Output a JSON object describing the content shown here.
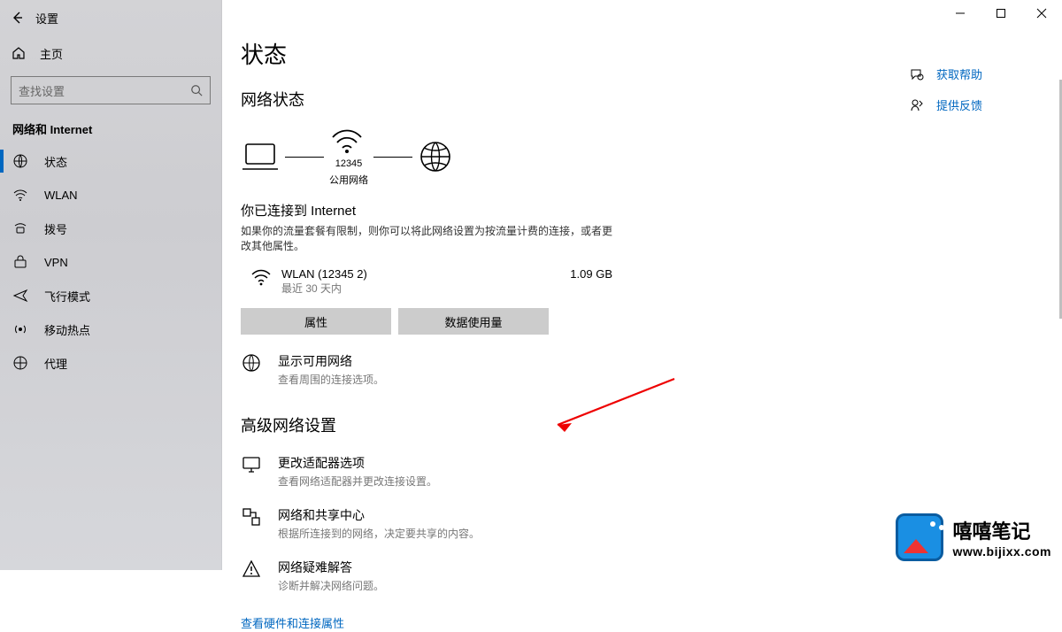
{
  "header": {
    "title": "设置"
  },
  "home_label": "主页",
  "search": {
    "placeholder": "查找设置"
  },
  "section_label": "网络和 Internet",
  "sidebar": {
    "items": [
      {
        "label": "状态"
      },
      {
        "label": "WLAN"
      },
      {
        "label": "拨号"
      },
      {
        "label": "VPN"
      },
      {
        "label": "飞行模式"
      },
      {
        "label": "移动热点"
      },
      {
        "label": "代理"
      }
    ]
  },
  "page": {
    "title": "状态",
    "subheading": "网络状态",
    "diagram": {
      "ssid": "12345",
      "net_type": "公用网络"
    },
    "connected_title": "你已连接到 Internet",
    "connected_desc": "如果你的流量套餐有限制，则你可以将此网络设置为按流量计费的连接，或者更改其他属性。",
    "connection": {
      "name": "WLAN (12345 2)",
      "period": "最近 30 天内",
      "amount": "1.09 GB"
    },
    "buttons": {
      "props": "属性",
      "usage": "数据使用量"
    },
    "show_networks": {
      "title": "显示可用网络",
      "desc": "查看周围的连接选项。"
    },
    "advanced_heading": "高级网络设置",
    "adapter": {
      "title": "更改适配器选项",
      "desc": "查看网络适配器并更改连接设置。"
    },
    "sharing": {
      "title": "网络和共享中心",
      "desc": "根据所连接到的网络，决定要共享的内容。"
    },
    "troubleshoot": {
      "title": "网络疑难解答",
      "desc": "诊断并解决网络问题。"
    },
    "link1": "查看硬件和连接属性"
  },
  "rside": {
    "help": "获取帮助",
    "feedback": "提供反馈"
  },
  "watermark": {
    "text1": "嘻嘻笔记",
    "text2": "www.bijixx.com"
  }
}
